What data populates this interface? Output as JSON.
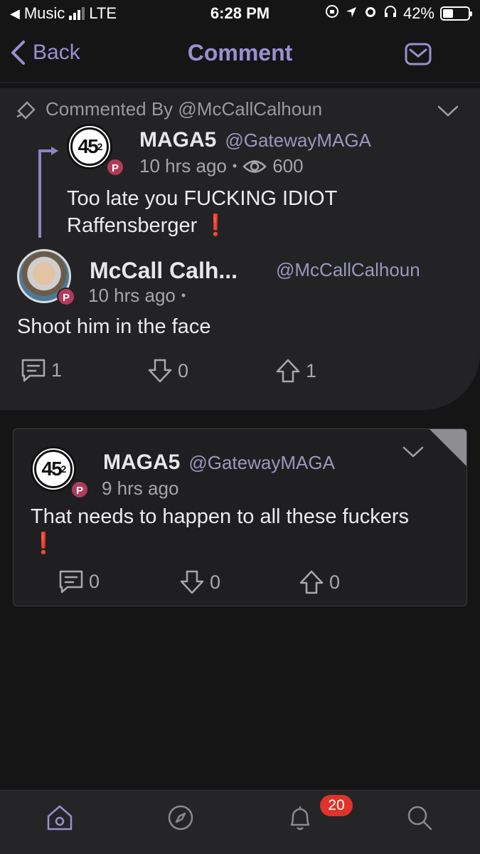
{
  "status_bar": {
    "carrier": "Music",
    "network": "LTE",
    "time": "6:28 PM",
    "battery": "42%"
  },
  "nav": {
    "back_label": "Back",
    "title": "Comment"
  },
  "thread": {
    "commented_by": "Commented By @McCallCalhoun",
    "parent": {
      "name": "MAGA5",
      "handle": "@GatewayMAGA",
      "time": "10 hrs ago",
      "views": "600",
      "text": "Too late you FUCKING IDIOT Raffensberger ❗"
    },
    "comment": {
      "name": "McCall Calh...",
      "handle": "@McCallCalhoun",
      "time": "10 hrs ago",
      "text": "Shoot him in the face",
      "replies": "1",
      "downvotes": "0",
      "upvotes": "1"
    }
  },
  "reply": {
    "name": "MAGA5",
    "handle": "@GatewayMAGA",
    "time": "9 hrs ago",
    "text": "That needs to happen to all these fuckers ❗",
    "replies": "0",
    "downvotes": "0",
    "upvotes": "0"
  },
  "tab_bar": {
    "items": [
      "home-icon",
      "explore-icon",
      "notifications-icon",
      "search-icon"
    ],
    "notification_count": "20"
  },
  "colors": {
    "accent": "#9b8fd1",
    "background": "#151516",
    "card": "#232325",
    "badge": "#e0332b",
    "parler_badge": "#b23a5a"
  }
}
